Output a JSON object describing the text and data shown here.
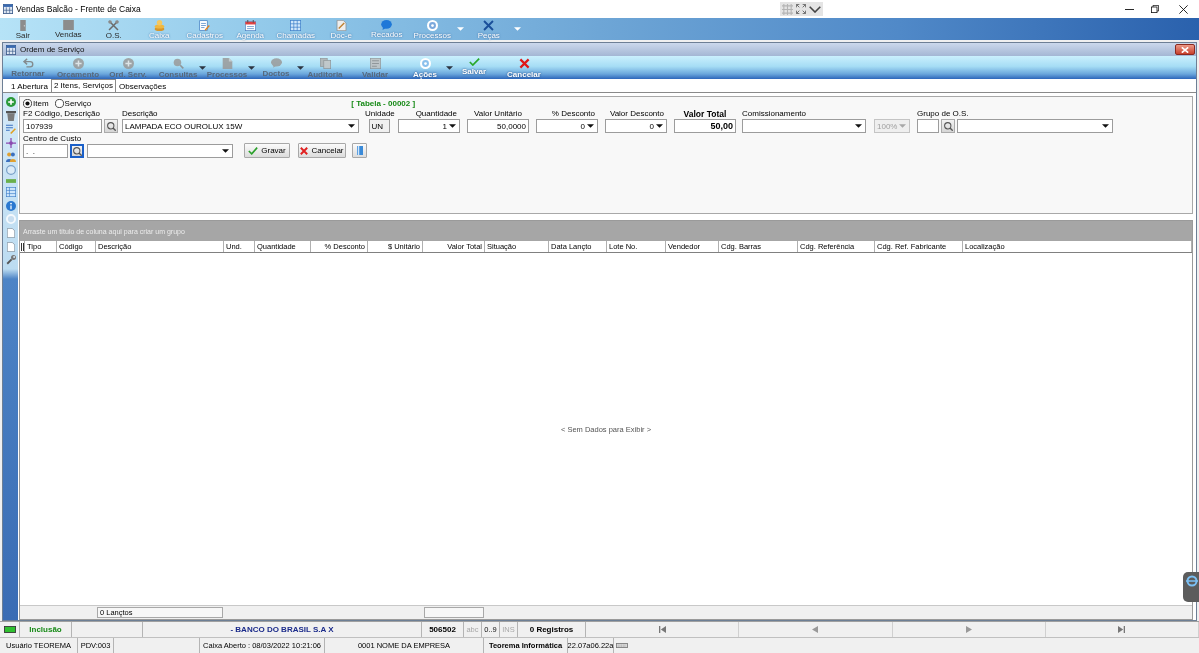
{
  "window": {
    "title": "Vendas Balcão - Frente de Caixa"
  },
  "main_toolbar": [
    {
      "label": "Sair",
      "disabled": true,
      "dropdown": false
    },
    {
      "label": "Vendas",
      "disabled": true,
      "dropdown": false
    },
    {
      "label": "O.S.",
      "disabled": true,
      "dropdown": false
    },
    {
      "label": "Caixa",
      "disabled": false,
      "dropdown": false
    },
    {
      "label": "Cadastros",
      "disabled": false,
      "dropdown": false
    },
    {
      "label": "Agenda",
      "disabled": false,
      "dropdown": false
    },
    {
      "label": "Chamadas",
      "disabled": false,
      "dropdown": false
    },
    {
      "label": "Doc-e",
      "disabled": false,
      "dropdown": false
    },
    {
      "label": "Recados",
      "disabled": false,
      "dropdown": false
    },
    {
      "label": "Processos",
      "disabled": false,
      "dropdown": true
    },
    {
      "label": "Peças",
      "disabled": false,
      "dropdown": true
    }
  ],
  "child_window": {
    "title": "Ordem de Serviço"
  },
  "child_toolbar": [
    {
      "label": "Retornar",
      "disabled": true,
      "dropdown": false
    },
    {
      "label": "Orçamento",
      "disabled": true,
      "dropdown": false
    },
    {
      "label": "Ord. Serv.",
      "disabled": true,
      "dropdown": false
    },
    {
      "label": "Consultas",
      "disabled": true,
      "dropdown": true
    },
    {
      "label": "Processos",
      "disabled": true,
      "dropdown": true
    },
    {
      "label": "Doctos",
      "disabled": true,
      "dropdown": true
    },
    {
      "label": "Auditoria",
      "disabled": true,
      "dropdown": false
    },
    {
      "label": "Validar",
      "disabled": true,
      "dropdown": false
    },
    {
      "label": "Ações",
      "disabled": false,
      "dropdown": true
    },
    {
      "label": "Salvar",
      "disabled": false,
      "dropdown": false
    },
    {
      "label": "Cancelar",
      "disabled": false,
      "dropdown": false
    }
  ],
  "tabs": [
    {
      "label": "1 Abertura",
      "selected": false
    },
    {
      "label": "2 Itens, Serviços",
      "selected": true
    },
    {
      "label": "Observações",
      "selected": false
    }
  ],
  "item_form": {
    "item_type": [
      {
        "label": "Item",
        "selected": true
      },
      {
        "label": "Serviço",
        "selected": false
      }
    ],
    "price_table": "[ Tabela - 00002 ]",
    "row_1": [
      {
        "kind": "lookup",
        "label": "F2 Código, Descrição",
        "value": "107939",
        "disabled": false,
        "focused": false
      },
      {
        "kind": "combo",
        "label": "Descrição",
        "value": "LAMPADA ECO OUROLUX 15W",
        "disabled": false,
        "focused": false
      },
      {
        "kind": "readonly",
        "label": "Unidade",
        "value": "UN",
        "disabled": false,
        "focused": false
      },
      {
        "kind": "number-combo",
        "label": "Quantidade",
        "value": "1",
        "disabled": false,
        "focused": false
      },
      {
        "kind": "number",
        "label": "Valor Unitário",
        "value": "50,0000",
        "disabled": false,
        "focused": false
      },
      {
        "kind": "number-combo",
        "label": "% Desconto",
        "value": "0",
        "disabled": false,
        "focused": false
      },
      {
        "kind": "number-combo",
        "label": "Valor Desconto",
        "value": "0",
        "disabled": false,
        "focused": false
      },
      {
        "kind": "total",
        "label": "Valor Total",
        "value": "50,00",
        "disabled": false,
        "focused": false
      },
      {
        "kind": "combo",
        "label": "Comissionamento",
        "disabled": false,
        "focused": false
      },
      {
        "kind": "combo",
        "value": "100%",
        "disabled": true,
        "focused": false
      },
      {
        "kind": "lookup",
        "label": "Grupo de O.S.",
        "disabled": false,
        "focused": false
      },
      {
        "kind": "combo",
        "disabled": false,
        "focused": false
      }
    ],
    "row_2": [
      {
        "kind": "lookup",
        "label": "Centro de Custo",
        "value": ".  .",
        "disabled": false,
        "focused": true
      },
      {
        "kind": "combo",
        "disabled": false,
        "focused": false
      }
    ],
    "buttons": [
      {
        "kind": "save",
        "label": "Gravar"
      },
      {
        "kind": "cancel",
        "label": "Cancelar"
      },
      {
        "kind": "book"
      }
    ]
  },
  "grid": {
    "group_hint": "Arraste um título de coluna aqui para criar um grupo",
    "columns": [
      {
        "title": "Tipo",
        "kind": "text",
        "footer_cell": false
      },
      {
        "title": "Código",
        "kind": "text",
        "footer_cell": false
      },
      {
        "title": "Descrição",
        "kind": "text",
        "footer_cell": true,
        "footer_text": "0 Lançtos"
      },
      {
        "title": "Und.",
        "kind": "text",
        "footer_cell": false
      },
      {
        "title": "Quantidade",
        "kind": "text",
        "footer_cell": false
      },
      {
        "title": "% Desconto",
        "kind": "number",
        "footer_cell": false
      },
      {
        "title": "$ Unitário",
        "kind": "number",
        "footer_cell": false
      },
      {
        "title": "Valor Total",
        "kind": "number",
        "footer_cell": true
      },
      {
        "title": "Situação",
        "kind": "text",
        "footer_cell": false
      },
      {
        "title": "Data Lançto",
        "kind": "text",
        "footer_cell": false
      },
      {
        "title": "Lote No.",
        "kind": "text",
        "footer_cell": false
      },
      {
        "title": "Vendedor",
        "kind": "text",
        "footer_cell": false
      },
      {
        "title": "Cdg. Barras",
        "kind": "text",
        "footer_cell": false
      },
      {
        "title": "Cdg. Referência",
        "kind": "text",
        "footer_cell": false
      },
      {
        "title": "Cdg. Ref. Fabricante",
        "kind": "text",
        "footer_cell": false
      },
      {
        "title": "Localização",
        "kind": "text",
        "footer_cell": false
      }
    ],
    "empty_text": "< Sem Dados para Exibir >"
  },
  "status_bar": {
    "mode": "Inclusão",
    "bank": "- BANCO DO BRASIL S.A X",
    "code": "506502",
    "indicators": [
      {
        "label": "abc",
        "on": false
      },
      {
        "label": "0..9",
        "on": true
      },
      {
        "label": "INS",
        "on": false
      }
    ],
    "records": "0 Registros"
  },
  "info_bar": {
    "user": "Usuário TEOREMA",
    "terminal": "PDV:003",
    "cash": "Caixa Aberto : 08/03/2022 10:21:06",
    "company": "0001 NOME DA EMPRESA",
    "developer": "Teorema Informática",
    "version": "22.07a06.22a"
  }
}
